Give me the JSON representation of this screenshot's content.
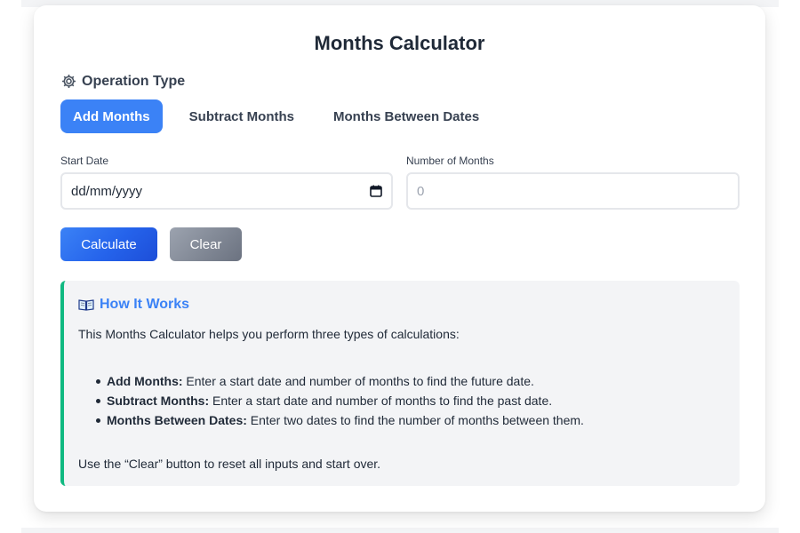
{
  "title": "Months Calculator",
  "operation": {
    "header": "Operation Type",
    "icon": "gear-icon",
    "tabs": [
      {
        "label": "Add Months",
        "active": true
      },
      {
        "label": "Subtract Months",
        "active": false
      },
      {
        "label": "Months Between Dates",
        "active": false
      }
    ]
  },
  "fields": {
    "start_date": {
      "label": "Start Date",
      "placeholder": "dd/mm/yyyy",
      "icon": "calendar-icon"
    },
    "months": {
      "label": "Number of Months",
      "placeholder": "0"
    }
  },
  "buttons": {
    "calculate": "Calculate",
    "clear": "Clear"
  },
  "info": {
    "icon": "book-icon",
    "title": "How It Works",
    "intro": "This Months Calculator helps you perform three types of calculations:",
    "items": [
      {
        "term": "Add Months:",
        "desc": " Enter a start date and number of months to find the future date."
      },
      {
        "term": "Subtract Months:",
        "desc": " Enter a start date and number of months to find the past date."
      },
      {
        "term": "Months Between Dates:",
        "desc": " Enter two dates to find the number of months between them."
      }
    ],
    "outro": "Use the “Clear” button to reset all inputs and start over."
  },
  "colors": {
    "accent": "#3b82f6",
    "info_border": "#10b981",
    "info_bg": "#f3f4f6",
    "clear_button": "#6b7280"
  }
}
